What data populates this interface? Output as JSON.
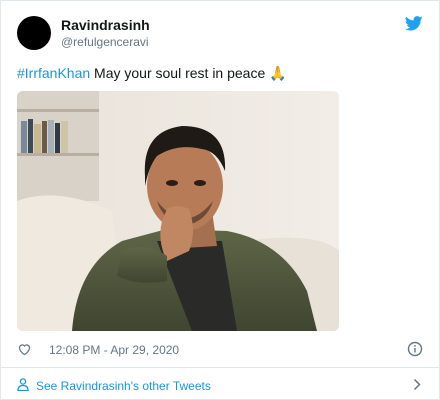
{
  "tweet": {
    "author": {
      "display_name": "Ravindrasinh",
      "handle": "@refulgenceravi"
    },
    "text": {
      "hashtag": "#IrrfanKhan",
      "body": " May your soul rest in peace ",
      "emoji": "🙏"
    },
    "timestamp": "12:08 PM - Apr 29, 2020",
    "icons": {
      "brand": "twitter-bird-icon",
      "like": "heart-icon",
      "info": "info-icon",
      "profile": "user-icon",
      "chevron": "chevron-right-icon"
    },
    "footer_link": "See Ravindrasinh's other Tweets",
    "colors": {
      "brand": "#1da1f2",
      "link": "#1b95e0",
      "muted": "#657786"
    }
  }
}
